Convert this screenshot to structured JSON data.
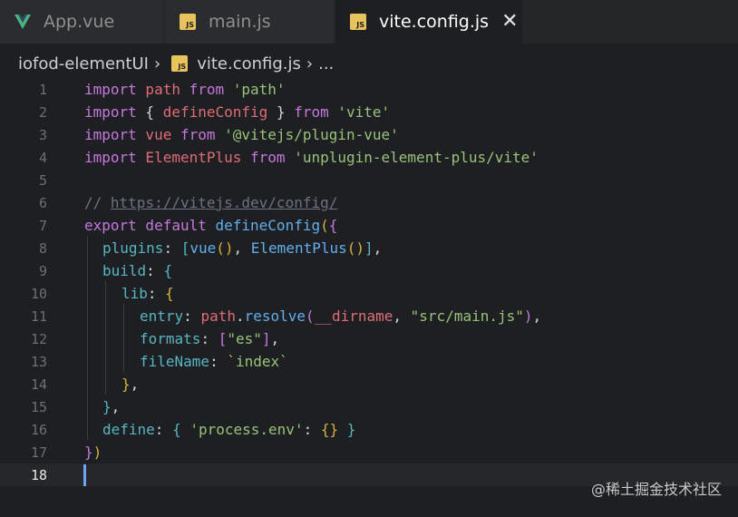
{
  "tabs": [
    {
      "label": "App.vue",
      "icon": "vue-icon",
      "active": false
    },
    {
      "label": "main.js",
      "icon": "js-icon",
      "active": false
    },
    {
      "label": "vite.config.js",
      "icon": "js-icon",
      "active": true
    }
  ],
  "icons": {
    "js_text": "JS",
    "close": "✕",
    "chevron": "›"
  },
  "breadcrumb": {
    "folder": "iofod-elementUI",
    "file": "vite.config.js",
    "more": "..."
  },
  "line_numbers": [
    "1",
    "2",
    "3",
    "4",
    "5",
    "6",
    "7",
    "8",
    "9",
    "10",
    "11",
    "12",
    "13",
    "14",
    "15",
    "16",
    "17",
    "18"
  ],
  "current_line": "18",
  "code": {
    "l1": {
      "k1": "import",
      "v1": " path ",
      "k2": "from",
      "s1": " 'path'"
    },
    "l2": {
      "k1": "import",
      "p1": " { ",
      "v1": "defineConfig",
      "p2": " } ",
      "k2": "from",
      "s1": " 'vite'"
    },
    "l3": {
      "k1": "import",
      "v1": " vue ",
      "k2": "from",
      "s1": " '@vitejs/plugin-vue'"
    },
    "l4": {
      "k1": "import",
      "v1": " ElementPlus ",
      "k2": "from",
      "s1": " 'unplugin-element-plus/vite'"
    },
    "l6": {
      "c1": "// ",
      "url": "https://vitejs.dev/config/"
    },
    "l7": {
      "k1": "export",
      "k2": " default ",
      "f1": "defineConfig",
      "b1": "(",
      "b2": "{"
    },
    "l8": {
      "p1": "plugins",
      "c": ": ",
      "b1": "[",
      "f1": "vue",
      "b2": "()",
      "cm": ", ",
      "f2": "ElementPlus",
      "b3": "()",
      "b4": "]",
      "e": ","
    },
    "l9": {
      "p1": "build",
      "c": ": ",
      "b1": "{"
    },
    "l10": {
      "p1": "lib",
      "c": ": ",
      "b1": "{"
    },
    "l11": {
      "p1": "entry",
      "c": ": ",
      "v1": "path",
      "d": ".",
      "f1": "resolve",
      "b1": "(",
      "v2": "__dirname",
      "cm": ", ",
      "s1": "\"src/main.js\"",
      "b2": ")",
      "e": ","
    },
    "l12": {
      "p1": "formats",
      "c": ": ",
      "b1": "[",
      "s1": "\"es\"",
      "b2": "]",
      "e": ","
    },
    "l13": {
      "p1": "fileName",
      "c": ": ",
      "s1": "`index`"
    },
    "l14": {
      "b1": "}",
      "e": ","
    },
    "l15": {
      "b1": "}",
      "e": ","
    },
    "l16": {
      "p1": "define",
      "c": ": ",
      "b1": "{ ",
      "s1": "'process.env'",
      "c2": ": ",
      "b2": "{}",
      "b3": " }"
    },
    "l17": {
      "b1": "}",
      "b2": ")"
    }
  },
  "watermark": "@稀土掘金技术社区",
  "colors": {
    "background": "#1e1f22",
    "keyword": "#c678dd",
    "string": "#98c379",
    "function": "#61afef",
    "property": "#56b6c2",
    "variable": "#e06c75",
    "caret": "#6fa3ff",
    "vue": "#41b883",
    "js_icon": "#e8c25a"
  }
}
